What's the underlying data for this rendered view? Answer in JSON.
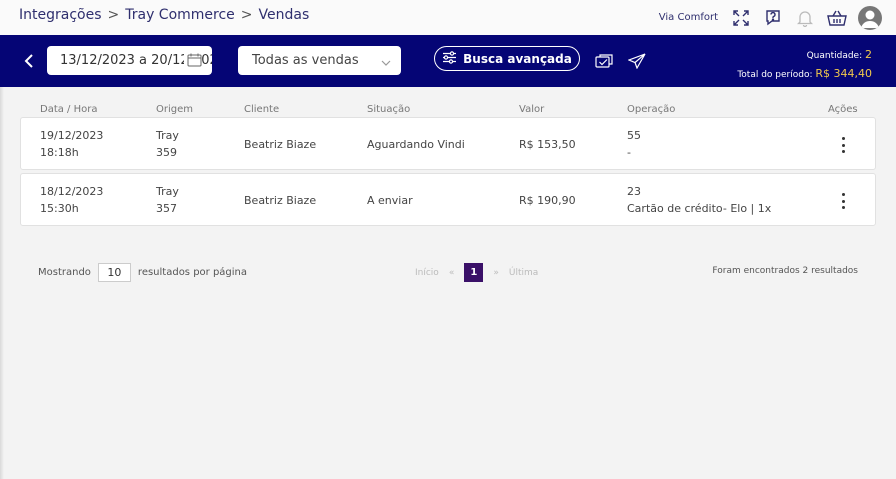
{
  "breadcrumb": {
    "items": [
      "Integrações",
      "Tray Commerce",
      "Vendas"
    ],
    "separator": ">"
  },
  "topbar": {
    "store_name": "Via Comfort",
    "icons": [
      "expand-icon",
      "help-chat-icon",
      "bell-icon",
      "basket-icon",
      "user-icon"
    ]
  },
  "toolbar": {
    "date_range": "13/12/2023 a 20/12/2023",
    "sales_filter": "Todas as vendas",
    "advanced_search_label": "Busca avançada",
    "quantity_label": "Quantidade:",
    "quantity_value": "2",
    "total_label": "Total do período:",
    "total_value": "R$ 344,40"
  },
  "table": {
    "columns": [
      "Data / Hora",
      "Origem",
      "Cliente",
      "Situação",
      "Valor",
      "Operação",
      "Ações"
    ],
    "rows": [
      {
        "date": "19/12/2023",
        "time": "18:18h",
        "origin": "Tray",
        "origin_id": "359",
        "client": "Beatriz Biaze",
        "status": "Aguardando Vindi",
        "value": "R$ 153,50",
        "operation": "55",
        "operation_detail": "-"
      },
      {
        "date": "18/12/2023",
        "time": "15:30h",
        "origin": "Tray",
        "origin_id": "357",
        "client": "Beatriz Biaze",
        "status": "A enviar",
        "value": "R$ 190,90",
        "operation": "23",
        "operation_detail": "Cartão de crédito- Elo | 1x"
      }
    ]
  },
  "pagination": {
    "showing_label": "Mostrando",
    "per_page": "10",
    "per_page_suffix": "resultados por página",
    "first_label": "Início",
    "prev_symbol": "«",
    "current_page": "1",
    "next_symbol": "»",
    "last_label": "Última",
    "results_text": "Foram encontrados 2 resultados"
  },
  "colors": {
    "navbar": "#050575",
    "accent_total": "#f2c94c",
    "page_active": "#3a1068"
  }
}
